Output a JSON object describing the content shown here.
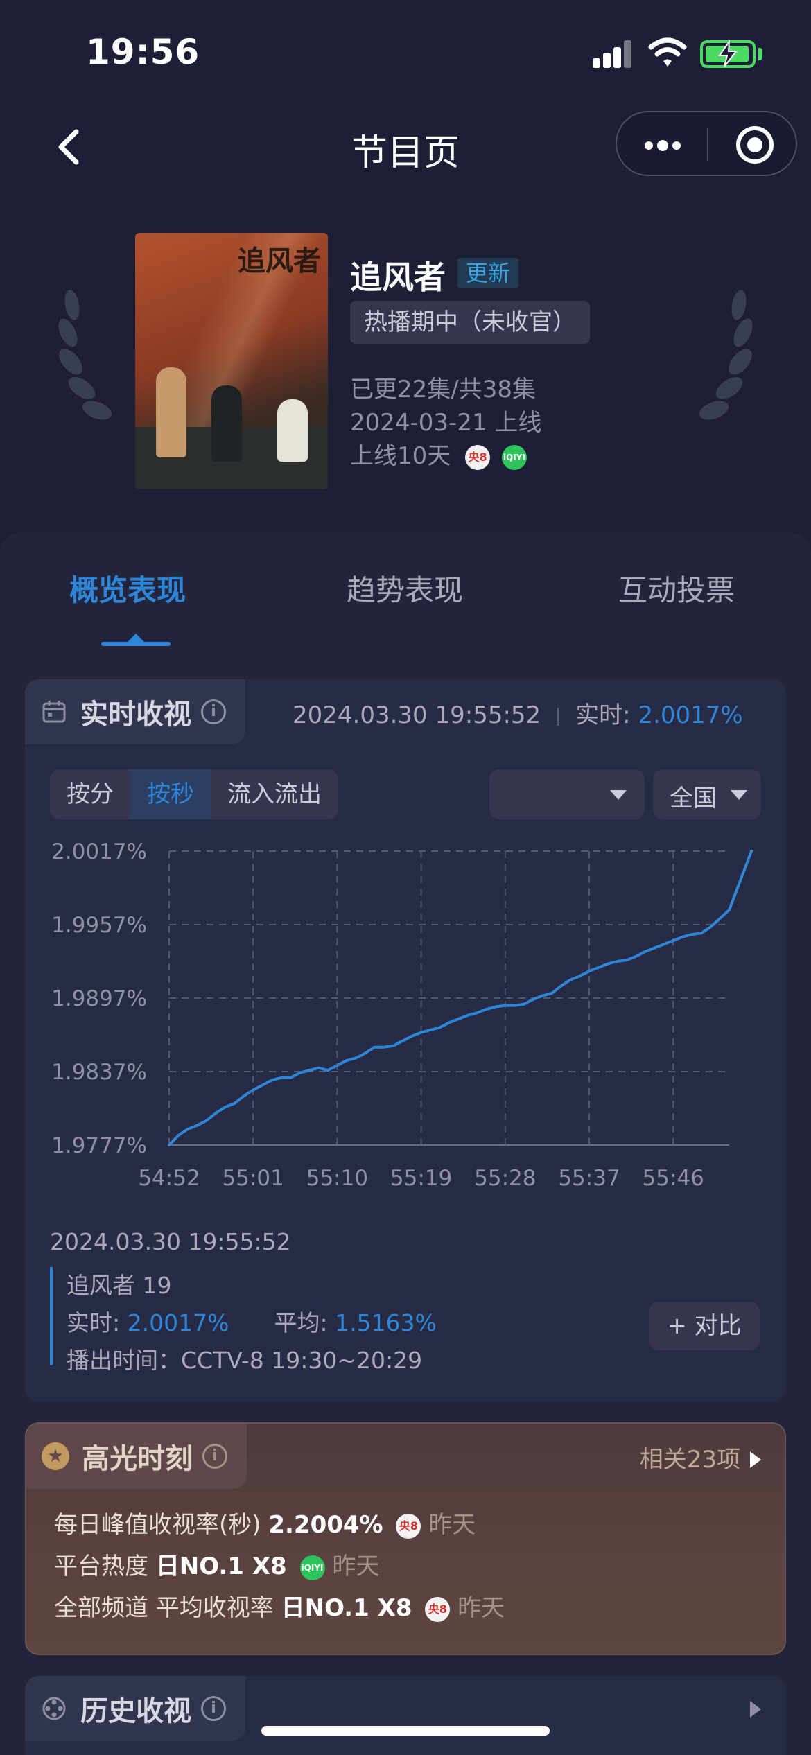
{
  "status_bar": {
    "time": "19:56"
  },
  "nav": {
    "title": "节目页"
  },
  "show": {
    "poster_title": "追风者",
    "title": "追风者",
    "update_badge": "更新",
    "status": "热播期中（未收官）",
    "episodes": "已更22集/共38集",
    "release": "2024-03-21 上线",
    "days_online": "上线10天",
    "platform_icons": [
      "cctv8-icon",
      "iqiyi-icon"
    ]
  },
  "tabs": [
    {
      "label": "概览表现",
      "active": true
    },
    {
      "label": "趋势表现",
      "active": false
    },
    {
      "label": "互动投票",
      "active": false
    }
  ],
  "realtime": {
    "title": "实时收视",
    "timestamp": "2024.03.30 19:55:52",
    "realtime_label": "实时:",
    "realtime_value": "2.0017%",
    "segments": [
      {
        "label": "按分",
        "active": false
      },
      {
        "label": "按秒",
        "active": true
      },
      {
        "label": "流入流出",
        "active": false
      }
    ],
    "dropdown_empty": "",
    "region": "全国",
    "detail_timestamp": "2024.03.30 19:55:52",
    "episode": "追风者 19",
    "rt_label": "实时:",
    "rt_value": "2.0017%",
    "avg_label": "平均:",
    "avg_value": "1.5163%",
    "airing": "播出时间：CCTV-8 19:30~20:29",
    "compare_button": "+ 对比"
  },
  "chart_data": {
    "type": "line",
    "x_ticks": [
      "54:52",
      "55:01",
      "55:10",
      "55:19",
      "55:28",
      "55:37",
      "55:46"
    ],
    "y_ticks": [
      "2.0017%",
      "1.9957%",
      "1.9897%",
      "1.9837%",
      "1.9777%"
    ],
    "ylim": [
      1.9777,
      2.0017
    ],
    "x_range_seconds": [
      0,
      60
    ],
    "grid": true,
    "series": [
      {
        "color": "#2e86d9",
        "points": [
          [
            0,
            1.9777
          ],
          [
            1,
            1.9785
          ],
          [
            2,
            1.979
          ],
          [
            3,
            1.9793
          ],
          [
            4,
            1.9797
          ],
          [
            5,
            1.9803
          ],
          [
            6,
            1.9808
          ],
          [
            7,
            1.9811
          ],
          [
            8,
            1.9817
          ],
          [
            9,
            1.9822
          ],
          [
            10,
            1.9826
          ],
          [
            11,
            1.983
          ],
          [
            12,
            1.9832
          ],
          [
            13,
            1.9832
          ],
          [
            14,
            1.9836
          ],
          [
            15,
            1.9838
          ],
          [
            16,
            1.984
          ],
          [
            17,
            1.9838
          ],
          [
            18,
            1.9842
          ],
          [
            19,
            1.9846
          ],
          [
            20,
            1.9848
          ],
          [
            21,
            1.9852
          ],
          [
            22,
            1.9857
          ],
          [
            23,
            1.9857
          ],
          [
            24,
            1.9858
          ],
          [
            25,
            1.9862
          ],
          [
            26,
            1.9866
          ],
          [
            27,
            1.9869
          ],
          [
            28,
            1.9871
          ],
          [
            29,
            1.9873
          ],
          [
            30,
            1.9877
          ],
          [
            31,
            1.988
          ],
          [
            32,
            1.9883
          ],
          [
            33,
            1.9885
          ],
          [
            34,
            1.9888
          ],
          [
            35,
            1.989
          ],
          [
            36,
            1.9891
          ],
          [
            37,
            1.9891
          ],
          [
            38,
            1.9892
          ],
          [
            39,
            1.9896
          ],
          [
            40,
            1.9899
          ],
          [
            41,
            1.9901
          ],
          [
            42,
            1.9907
          ],
          [
            43,
            1.9912
          ],
          [
            44,
            1.9915
          ],
          [
            45,
            1.9919
          ],
          [
            46,
            1.9922
          ],
          [
            47,
            1.9925
          ],
          [
            48,
            1.9927
          ],
          [
            49,
            1.9928
          ],
          [
            50,
            1.9931
          ],
          [
            51,
            1.9935
          ],
          [
            52,
            1.9938
          ],
          [
            53,
            1.9941
          ],
          [
            54,
            1.9944
          ],
          [
            55,
            1.9947
          ],
          [
            56,
            1.9949
          ],
          [
            57,
            1.995
          ],
          [
            58,
            1.9955
          ],
          [
            59,
            1.9962
          ],
          [
            60,
            1.9969
          ]
        ]
      }
    ]
  },
  "highlights": {
    "title": "高光时刻",
    "related": "相关23项",
    "rows": [
      {
        "label": "每日峰值收视率(秒)",
        "value": "2.2004%",
        "icon": "cctv8-icon",
        "when": "昨天"
      },
      {
        "label": "平台热度",
        "value": "日NO.1 X8",
        "icon": "iqiyi-icon",
        "when": "昨天"
      },
      {
        "label": "全部频道 平均收视率",
        "value": "日NO.1 X8",
        "icon": "cctv8-icon",
        "when": "昨天"
      }
    ]
  },
  "history": {
    "title": "历史收视"
  },
  "icons": {
    "cctv8_text": "央8",
    "iqiyi_text": "iQIYI",
    "info_glyph": "i"
  }
}
